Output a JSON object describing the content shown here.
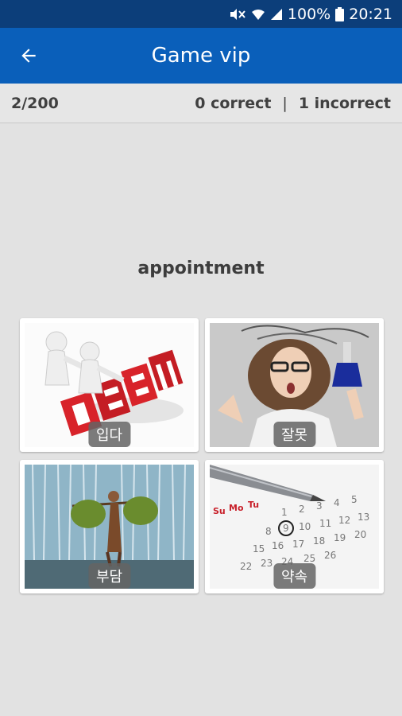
{
  "status_bar": {
    "battery": "100%",
    "time": "20:21"
  },
  "app_bar": {
    "title": "Game vip"
  },
  "score": {
    "progress": "2/200",
    "correct": "0 correct",
    "separator": "|",
    "incorrect": "1 incorrect"
  },
  "question": {
    "word": "appointment"
  },
  "options": [
    {
      "label": "입다"
    },
    {
      "label": "잘못"
    },
    {
      "label": "부담"
    },
    {
      "label": "약속"
    }
  ],
  "colors": {
    "status_bar": "#0c3e7a",
    "app_bar": "#0a5fba",
    "background": "#e2e2e2"
  }
}
